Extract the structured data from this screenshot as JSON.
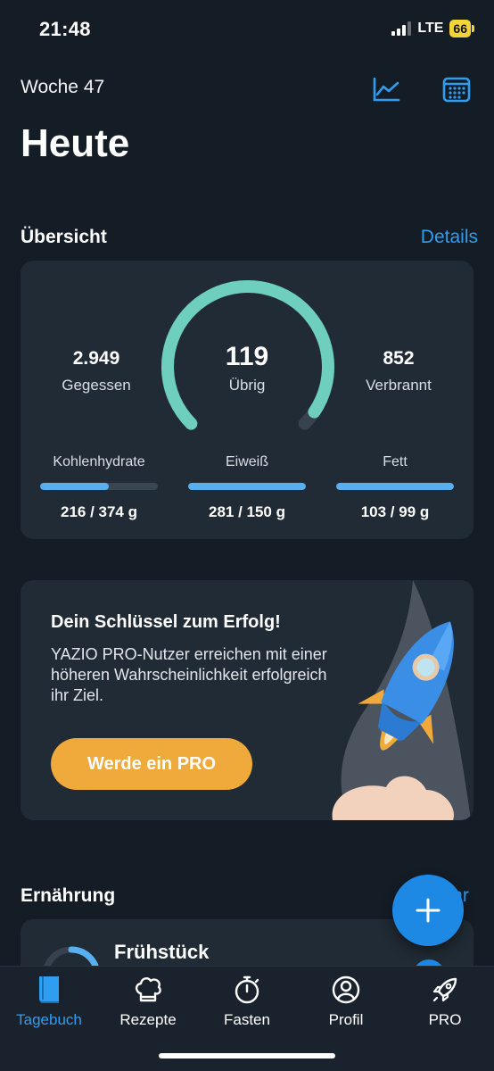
{
  "status_bar": {
    "time": "21:48",
    "network": "LTE",
    "battery": "66"
  },
  "header": {
    "week": "Woche 47",
    "title": "Heute",
    "icons": [
      "chart-icon",
      "calendar-icon"
    ]
  },
  "overview": {
    "title": "Übersicht",
    "details_label": "Details",
    "eaten": {
      "value": "2.949",
      "label": "Gegessen"
    },
    "remaining": {
      "value": "119",
      "label": "Übrig"
    },
    "burned": {
      "value": "852",
      "label": "Verbrannt"
    },
    "remaining_progress": 0.96,
    "macros": [
      {
        "label": "Kohlenhydrate",
        "value": "216 / 374 g",
        "progress": 0.58
      },
      {
        "label": "Eiweiß",
        "value": "281 / 150 g",
        "progress": 1.0
      },
      {
        "label": "Fett",
        "value": "103 / 99 g",
        "progress": 1.0
      }
    ]
  },
  "promo": {
    "title": "Dein Schlüssel zum Erfolg!",
    "text": "YAZIO PRO-Nutzer erreichen mit einer höheren Wahrscheinlichkeit erfolgreich ihr Ziel.",
    "button_label": "Werde ein PRO"
  },
  "nutrition": {
    "title": "Ernährung",
    "link_label": "Mehr",
    "first_meal": "Frühstück"
  },
  "fab": {
    "icon": "plus-icon"
  },
  "tabs": [
    {
      "label": "Tagebuch",
      "icon": "book-icon",
      "active": true
    },
    {
      "label": "Rezepte",
      "icon": "chef-hat-icon",
      "active": false
    },
    {
      "label": "Fasten",
      "icon": "stopwatch-icon",
      "active": false
    },
    {
      "label": "Profil",
      "icon": "person-icon",
      "active": false
    },
    {
      "label": "PRO",
      "icon": "rocket-icon",
      "active": false
    }
  ],
  "colors": {
    "accent": "#2f9df0",
    "gauge": "#6ecfbe",
    "macro_bar": "#58b0f0",
    "promo_button": "#f0a93b",
    "background": "#141c26",
    "card": "#212b35"
  }
}
